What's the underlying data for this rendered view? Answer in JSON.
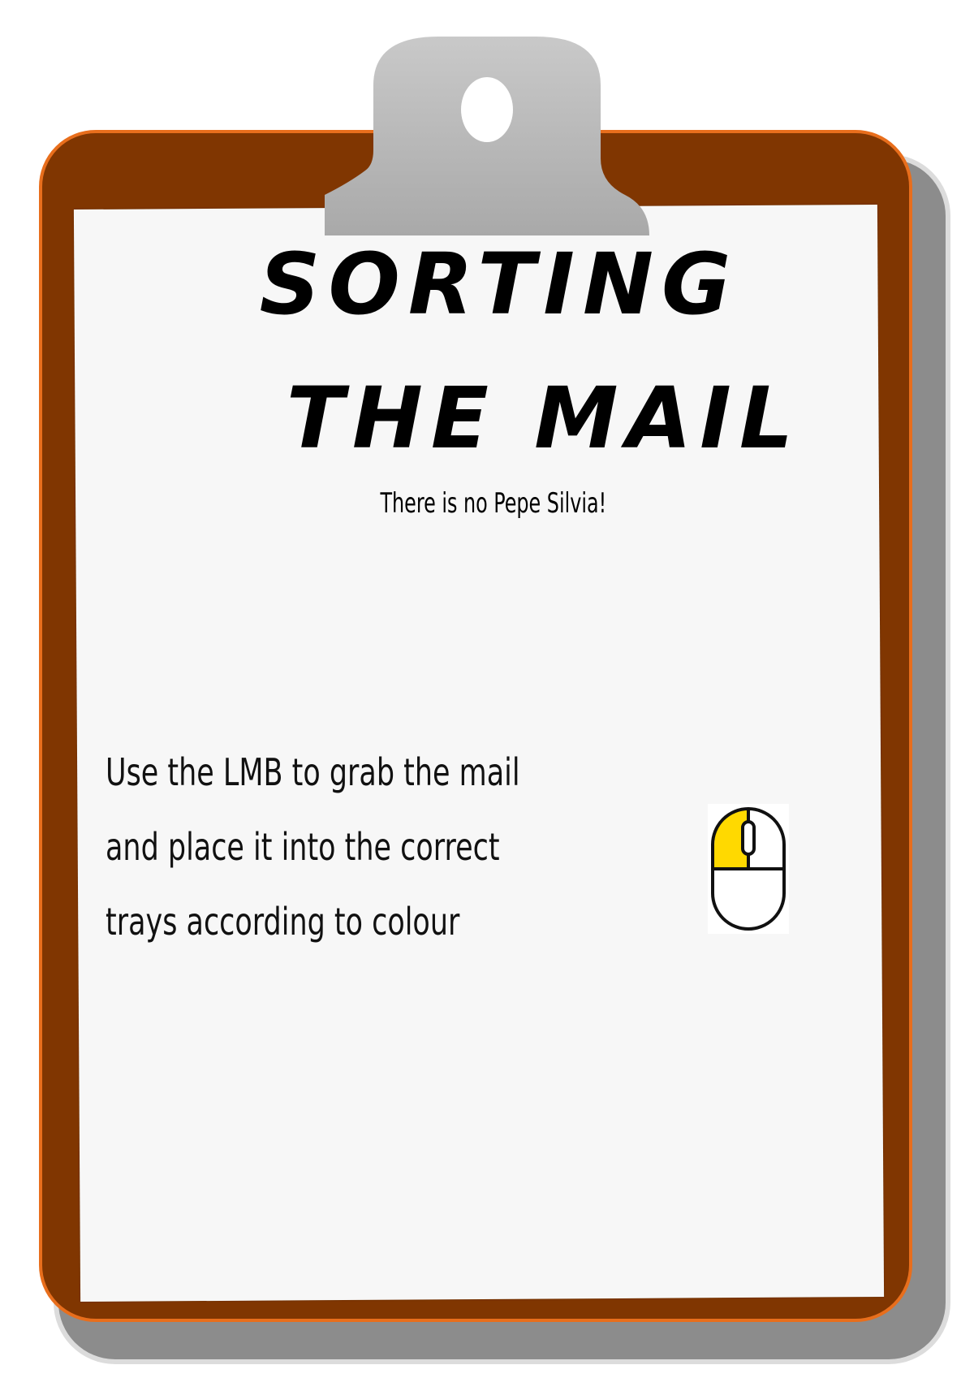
{
  "title": {
    "line1": "SORTING",
    "line2": "THE MAIL"
  },
  "subtitle": "There is no Pepe Silvia!",
  "instructions": {
    "line1": "Use the LMB to grab the mail",
    "line2": "and place it into the correct",
    "line3": "trays according to colour"
  },
  "icons": {
    "mouse": "mouse-left-button-icon",
    "clip": "clipboard-clip-icon"
  },
  "colors": {
    "board": "#803601",
    "board_border": "#e86e1c",
    "paper": "#f7f7f7",
    "clip": "#b5b5b5",
    "mouse_highlight": "#ffd900"
  }
}
